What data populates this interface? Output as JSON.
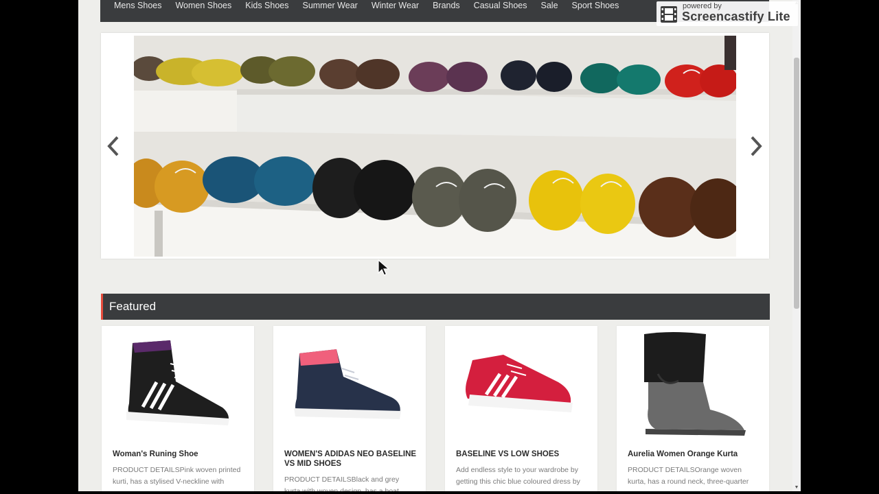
{
  "nav": {
    "items": [
      "Mens Shoes",
      "Women Shoes",
      "Kids Shoes",
      "Summer Wear",
      "Winter Wear",
      "Brands",
      "Casual Shoes",
      "Sale",
      "Sport Shoes"
    ]
  },
  "slider": {
    "prev_icon": "chevron-left-icon",
    "next_icon": "chevron-right-icon"
  },
  "featured": {
    "title": "Featured"
  },
  "products": [
    {
      "title": "Woman's Runing Shoe",
      "desc": "PRODUCT DETAILSPink woven printed kurti, has a stylised V-neckline with"
    },
    {
      "title": "WOMEN'S ADIDAS NEO BASELINE VS MID SHOES",
      "desc": "PRODUCT DETAILSBlack and grey kurta with woven design, has a boat neck"
    },
    {
      "title": "BASELINE VS LOW SHOES",
      "desc": "Add endless style to your wardrobe by getting this chic blue coloured dress by"
    },
    {
      "title": "Aurelia Women Orange Kurta",
      "desc": "PRODUCT DETAILSOrange woven kurta, has a round neck, three-quarter"
    }
  ],
  "badge": {
    "sub": "powered by",
    "main": "Screencastify Lite"
  },
  "colors": {
    "nav_bg": "#3a3c3e",
    "accent": "#e74c3c",
    "page_bg": "#eeeeeb"
  }
}
